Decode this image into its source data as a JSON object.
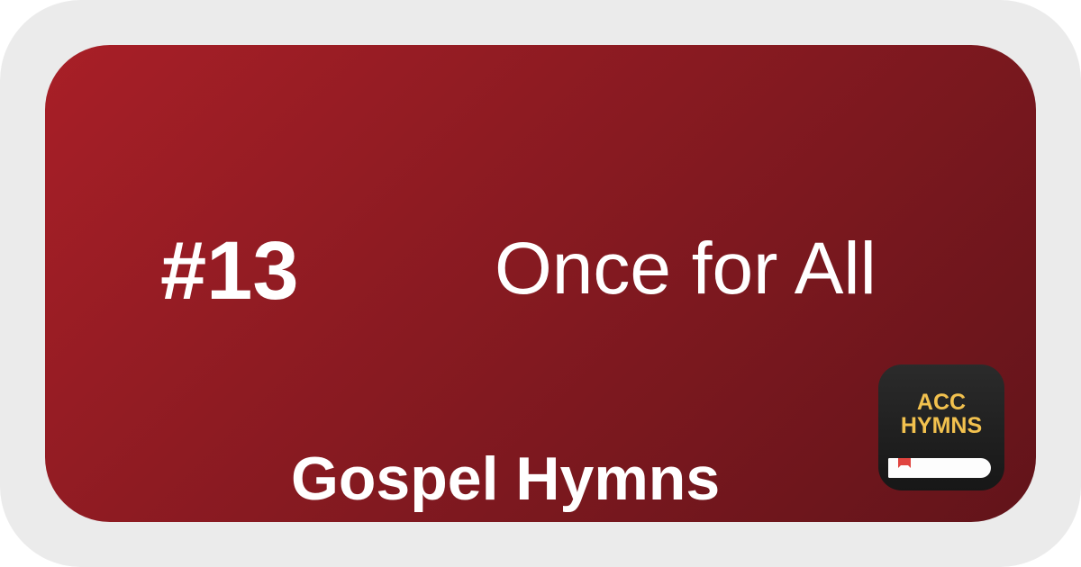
{
  "card": {
    "number": "#13",
    "title": "Once for All",
    "hymnal": "Gospel Hymns"
  },
  "app_icon": {
    "name": "book-icon",
    "line1": "ACC",
    "line2": "HYMNS"
  },
  "colors": {
    "page_background": "#ebebeb",
    "card_gradient_start": "#a81f27",
    "card_gradient_end": "#62141a",
    "text": "#ffffff",
    "icon_text": "#f2c14e",
    "bookmark": "#e0443f"
  }
}
